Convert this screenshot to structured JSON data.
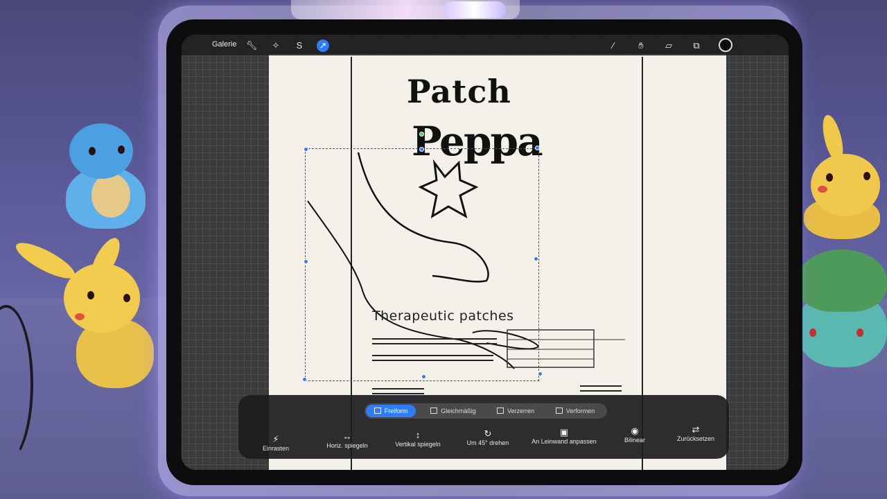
{
  "topbar": {
    "gallery_label": "Galerie",
    "left_icons": [
      "wrench-icon",
      "magic-wand-icon",
      "selection-s-icon",
      "transform-arrow-icon"
    ],
    "right_icons": [
      "brush-icon",
      "smudge-icon",
      "eraser-icon",
      "layers-icon",
      "color-swatch-icon"
    ],
    "active_tool": "transform-arrow-icon",
    "accent_color": "#2f7cf6",
    "current_color": "#0c0c0c"
  },
  "artwork": {
    "title_line1": "Patch",
    "title_line2": "Peppa",
    "subtitle": "Therapeutic patches"
  },
  "transform": {
    "modes": [
      {
        "label": "Freiform",
        "active": true
      },
      {
        "label": "Gleichmäßig",
        "active": false
      },
      {
        "label": "Verzerren",
        "active": false
      },
      {
        "label": "Verformen",
        "active": false
      }
    ],
    "actions": [
      {
        "label": "Einrasten",
        "icon": "snap-icon"
      },
      {
        "label": "Horiz. spiegeln",
        "icon": "flip-horizontal-icon"
      },
      {
        "label": "Vertikal spiegeln",
        "icon": "flip-vertical-icon"
      },
      {
        "label": "Um 45° drehen",
        "icon": "rotate-icon"
      },
      {
        "label": "An Leinwand anpassen",
        "icon": "fit-canvas-icon"
      },
      {
        "label": "Bilinear",
        "icon": "interpolation-icon"
      },
      {
        "label": "Zurücksetzen",
        "icon": "reset-icon"
      }
    ]
  }
}
